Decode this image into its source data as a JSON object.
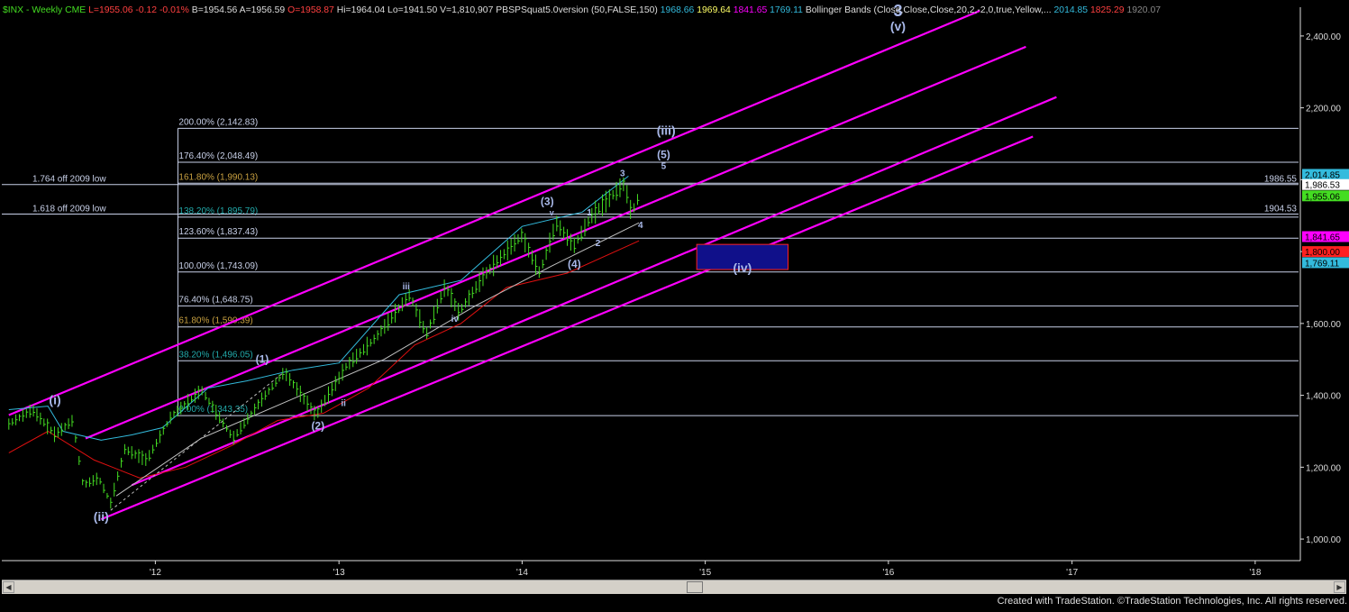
{
  "header": {
    "symbol": "$INX - Weekly",
    "exchange": "CME",
    "last": "L=1955.06",
    "change": "-0.12",
    "change_pct": "-0.01%",
    "bid": "B=1954.56",
    "ask": "A=1956.59",
    "open": "O=1958.87",
    "high": "Hi=1964.04",
    "low": "Lo=1941.50",
    "volume": "V=1,810,907",
    "indicator_name": "PBSPSquat5.0version (50,FALSE,150)",
    "indicator_values": [
      "1968.66",
      "1969.64",
      "1841.65",
      "1769.11"
    ],
    "bb_name": "Bollinger Bands (Close,Close,Close,20,2,-2,0,true,Yellow,...",
    "bb_values": [
      "2014.85",
      "1825.29",
      "1920.07"
    ]
  },
  "colors": {
    "background": "#000000",
    "channel": "#ff00ff",
    "fib_line": "#c8d0e8",
    "price_bars": "#44dd22",
    "red_line": "#e01010",
    "white_line": "#c0c0c0",
    "cyan_line": "#33bbdd",
    "wave_label": "#a8b8e8",
    "target_box_fill": "#10108a",
    "target_box_border": "#ff2020",
    "fib_gold": "#c8a040",
    "fib_teal": "#22aaaa"
  },
  "footer": "Created with TradeStation. ©TradeStation Technologies, Inc. All rights reserved.",
  "chart_data": {
    "type": "line",
    "title": "$INX - Weekly",
    "x_ticks": [
      "'12",
      "'13",
      "'14",
      "'15",
      "'16",
      "'17",
      "'18"
    ],
    "xlim": [
      "2011-03",
      "2018-04"
    ],
    "y_ticks": [
      "1,000.00",
      "1,200.00",
      "1,400.00",
      "1,600.00",
      "1,800.00",
      "2,000.00",
      "2,200.00",
      "2,400.00"
    ],
    "ylim": [
      940,
      2480
    ],
    "grid": false,
    "fib_levels": [
      {
        "label": "200.00% (2,142.83)",
        "value": 2142.83
      },
      {
        "label": "176.40% (2,048.49)",
        "value": 2048.49
      },
      {
        "label": "161.80% (1,990.13)",
        "value": 1990.13
      },
      {
        "label": "138.20% (1,895.79)",
        "value": 1895.79
      },
      {
        "label": "123.60% (1,837.43)",
        "value": 1837.43
      },
      {
        "label": "100.00% (1,743.09)",
        "value": 1743.09
      },
      {
        "label": "76.40% (1,648.75)",
        "value": 1648.75
      },
      {
        "label": "61.80% (1,590.39)",
        "value": 1590.39
      },
      {
        "label": "38.20% (1,496.05)",
        "value": 1496.05
      },
      {
        "label": "0.00% (1,343.35)",
        "value": 1343.35
      }
    ],
    "horizontal_lines": [
      {
        "label": "1.764 off 2009 low",
        "value": 1986.55,
        "right_label": "1986.55"
      },
      {
        "label": "1.618 off 2009 low",
        "value": 1904.53,
        "right_label": "1904.53"
      }
    ],
    "price_tags": [
      {
        "text": "2,014.85",
        "value": 2014.85,
        "bg": "#33bbdd",
        "fg": "#000000"
      },
      {
        "text": "1,986.53",
        "value": 1986.53,
        "bg": "#ffffff",
        "fg": "#000000"
      },
      {
        "text": "1,955.06",
        "value": 1955.06,
        "bg": "#44dd22",
        "fg": "#000000"
      },
      {
        "text": "1,841.65",
        "value": 1841.65,
        "bg": "#ff00ff",
        "fg": "#000000"
      },
      {
        "text": "1,800.00",
        "value": 1800.0,
        "bg": "#ff2020",
        "fg": "#000000"
      },
      {
        "text": "1,769.11",
        "value": 1769.11,
        "bg": "#33bbdd",
        "fg": "#000000"
      }
    ],
    "price_series": [
      {
        "x": "2011-03-15",
        "y": 1320
      },
      {
        "x": "2011-05-01",
        "y": 1360
      },
      {
        "x": "2011-06-15",
        "y": 1290
      },
      {
        "x": "2011-07-20",
        "y": 1330
      },
      {
        "x": "2011-08-10",
        "y": 1150
      },
      {
        "x": "2011-09-10",
        "y": 1170
      },
      {
        "x": "2011-10-04",
        "y": 1100
      },
      {
        "x": "2011-11-01",
        "y": 1250
      },
      {
        "x": "2011-12-15",
        "y": 1220
      },
      {
        "x": "2012-02-01",
        "y": 1340
      },
      {
        "x": "2012-04-02",
        "y": 1415
      },
      {
        "x": "2012-06-04",
        "y": 1280
      },
      {
        "x": "2012-08-01",
        "y": 1390
      },
      {
        "x": "2012-09-14",
        "y": 1465
      },
      {
        "x": "2012-11-16",
        "y": 1345
      },
      {
        "x": "2013-01-15",
        "y": 1480
      },
      {
        "x": "2013-03-15",
        "y": 1560
      },
      {
        "x": "2013-05-22",
        "y": 1680
      },
      {
        "x": "2013-06-24",
        "y": 1570
      },
      {
        "x": "2013-08-01",
        "y": 1705
      },
      {
        "x": "2013-08-28",
        "y": 1630
      },
      {
        "x": "2013-10-15",
        "y": 1730
      },
      {
        "x": "2013-12-31",
        "y": 1845
      },
      {
        "x": "2014-02-05",
        "y": 1740
      },
      {
        "x": "2014-03-10",
        "y": 1880
      },
      {
        "x": "2014-04-14",
        "y": 1815
      },
      {
        "x": "2014-05-20",
        "y": 1900
      },
      {
        "x": "2014-07-24",
        "y": 1990
      },
      {
        "x": "2014-08-07",
        "y": 1905
      },
      {
        "x": "2014-08-22",
        "y": 1955
      }
    ],
    "white_ma": [
      {
        "x": "2011-10-15",
        "y": 1120
      },
      {
        "x": "2012-04-01",
        "y": 1280
      },
      {
        "x": "2012-10-01",
        "y": 1390
      },
      {
        "x": "2013-04-01",
        "y": 1500
      },
      {
        "x": "2013-10-01",
        "y": 1650
      },
      {
        "x": "2014-03-01",
        "y": 1760
      },
      {
        "x": "2014-08-22",
        "y": 1880
      }
    ],
    "cyan_line": [
      {
        "x": "2011-03-15",
        "y": 1360
      },
      {
        "x": "2011-06-01",
        "y": 1370
      },
      {
        "x": "2011-07-01",
        "y": 1300
      },
      {
        "x": "2011-09-15",
        "y": 1275
      },
      {
        "x": "2011-11-15",
        "y": 1290
      },
      {
        "x": "2012-01-15",
        "y": 1310
      },
      {
        "x": "2012-04-15",
        "y": 1420
      },
      {
        "x": "2012-07-01",
        "y": 1440
      },
      {
        "x": "2012-10-01",
        "y": 1470
      },
      {
        "x": "2013-01-01",
        "y": 1490
      },
      {
        "x": "2013-05-01",
        "y": 1680
      },
      {
        "x": "2013-09-01",
        "y": 1720
      },
      {
        "x": "2014-01-01",
        "y": 1870
      },
      {
        "x": "2014-05-01",
        "y": 1910
      },
      {
        "x": "2014-08-01",
        "y": 2010
      }
    ],
    "red_line": [
      {
        "x": "2011-03-15",
        "y": 1240
      },
      {
        "x": "2011-06-01",
        "y": 1300
      },
      {
        "x": "2011-09-01",
        "y": 1220
      },
      {
        "x": "2011-12-01",
        "y": 1170
      },
      {
        "x": "2012-03-01",
        "y": 1200
      },
      {
        "x": "2012-06-01",
        "y": 1260
      },
      {
        "x": "2012-09-01",
        "y": 1330
      },
      {
        "x": "2012-12-01",
        "y": 1350
      },
      {
        "x": "2013-03-01",
        "y": 1420
      },
      {
        "x": "2013-06-01",
        "y": 1540
      },
      {
        "x": "2013-09-01",
        "y": 1600
      },
      {
        "x": "2013-12-01",
        "y": 1700
      },
      {
        "x": "2014-04-01",
        "y": 1740
      },
      {
        "x": "2014-08-22",
        "y": 1830
      }
    ],
    "channels": [
      {
        "x1": "2011-03-15",
        "y1": 1345,
        "x2": "2016-07-01",
        "y2": 2470
      },
      {
        "x1": "2011-08-15",
        "y1": 1280,
        "x2": "2016-10-01",
        "y2": 2370
      },
      {
        "x1": "2011-11-15",
        "y1": 1150,
        "x2": "2016-12-01",
        "y2": 2230
      },
      {
        "x1": "2011-09-15",
        "y1": 1055,
        "x2": "2016-10-15",
        "y2": 2120
      }
    ],
    "dashed_line": {
      "x1": "2011-10-04",
      "y1": 1080,
      "x2": "2012-09-14",
      "y2": 1465
    },
    "target_box": {
      "x1": "2014-12-15",
      "x2": "2015-06-15",
      "y1": 1750,
      "y2": 1820,
      "label": "(iv)"
    },
    "wave_labels": [
      {
        "text": "(i)",
        "x": "2011-06-15",
        "y": 1375,
        "size": 14
      },
      {
        "text": "(ii)",
        "x": "2011-09-15",
        "y": 1050,
        "size": 14
      },
      {
        "text": "(1)",
        "x": "2012-08-01",
        "y": 1490,
        "size": 12
      },
      {
        "text": "(2)",
        "x": "2012-11-20",
        "y": 1305,
        "size": 12
      },
      {
        "text": "iii",
        "x": "2013-05-15",
        "y": 1695,
        "size": 10
      },
      {
        "text": "iv",
        "x": "2013-08-20",
        "y": 1605,
        "size": 10
      },
      {
        "text": "ii",
        "x": "2013-01-10",
        "y": 1370,
        "size": 10
      },
      {
        "text": "(3)",
        "x": "2014-02-20",
        "y": 1930,
        "size": 12
      },
      {
        "text": "v",
        "x": "2014-03-01",
        "y": 1900,
        "size": 9
      },
      {
        "text": "(4)",
        "x": "2014-04-15",
        "y": 1755,
        "size": 12
      },
      {
        "text": "1",
        "x": "2014-05-15",
        "y": 1900,
        "size": 10
      },
      {
        "text": "2",
        "x": "2014-06-01",
        "y": 1815,
        "size": 10
      },
      {
        "text": "3",
        "x": "2014-07-20",
        "y": 2010,
        "size": 10
      },
      {
        "text": "4",
        "x": "2014-08-25",
        "y": 1865,
        "size": 10
      },
      {
        "text": "5",
        "x": "2014-10-10",
        "y": 2030,
        "size": 10
      },
      {
        "text": "(5)",
        "x": "2014-10-10",
        "y": 2060,
        "size": 12
      },
      {
        "text": "(iii)",
        "x": "2014-10-15",
        "y": 2125,
        "size": 14
      },
      {
        "text": "3",
        "x": "2016-01-20",
        "y": 2455,
        "size": 18
      },
      {
        "text": "(v)",
        "x": "2016-01-20",
        "y": 2415,
        "size": 14
      }
    ]
  }
}
